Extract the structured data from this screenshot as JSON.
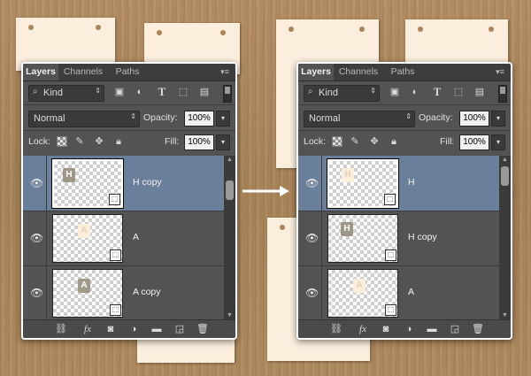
{
  "left": {
    "tabs": [
      "Layers",
      "Channels",
      "Paths"
    ],
    "kind_label": "Kind",
    "blend_mode": "Normal",
    "opacity_label": "Opacity:",
    "opacity_value": "100%",
    "lock_label": "Lock:",
    "fill_label": "Fill:",
    "fill_value": "100%",
    "layers": [
      {
        "name": "H copy",
        "selected": true
      },
      {
        "name": "A",
        "selected": false
      },
      {
        "name": "A copy",
        "selected": false
      }
    ]
  },
  "right": {
    "tabs": [
      "Layers",
      "Channels",
      "Paths"
    ],
    "kind_label": "Kind",
    "blend_mode": "Normal",
    "opacity_label": "Opacity:",
    "opacity_value": "100%",
    "lock_label": "Lock:",
    "fill_label": "Fill:",
    "fill_value": "100%",
    "layers": [
      {
        "name": "H",
        "selected": true
      },
      {
        "name": "H copy",
        "selected": false
      },
      {
        "name": "A",
        "selected": false
      }
    ]
  },
  "colors": {
    "selection": "#6a7f99",
    "panel": "#535353",
    "cardboard": "#ab865b",
    "tag": "#fbeedd"
  },
  "icons": [
    "search-icon",
    "image-filter-icon",
    "adjustment-filter-icon",
    "type-filter-icon",
    "shape-filter-icon",
    "smart-object-filter-icon",
    "lock-transparent-icon",
    "lock-paint-icon",
    "lock-position-icon",
    "lock-all-icon",
    "eye-icon",
    "link-icon",
    "fx-icon",
    "mask-icon",
    "adjustment-icon",
    "folder-icon",
    "new-layer-icon",
    "trash-icon"
  ]
}
